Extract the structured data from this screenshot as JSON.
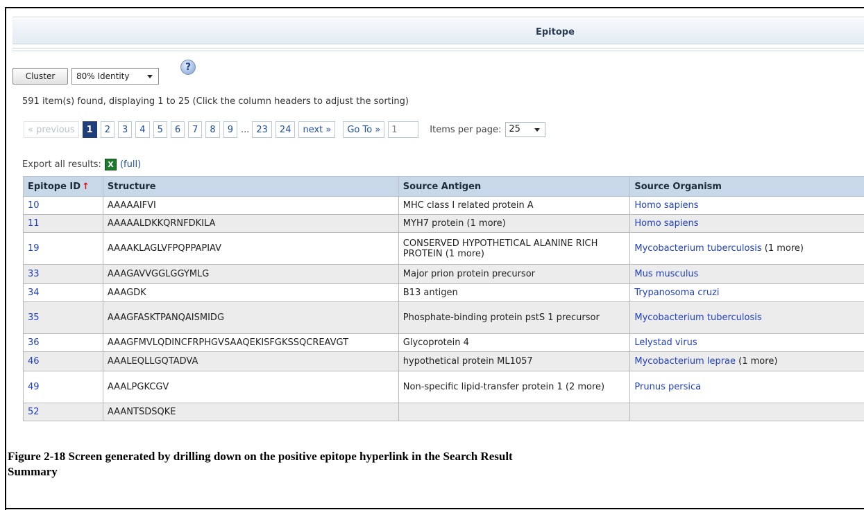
{
  "header": {
    "title": "Epitope"
  },
  "toolbar": {
    "cluster_label": "Cluster",
    "identity_value": "80% Identity",
    "help_icon_glyph": "?"
  },
  "summary": {
    "found_text": "591 item(s) found, displaying 1 to 25 (Click the column headers to adjust the sorting)"
  },
  "pager": {
    "previous_label": "« previous",
    "pages": [
      "1",
      "2",
      "3",
      "4",
      "5",
      "6",
      "7",
      "8",
      "9"
    ],
    "ellipsis": "...",
    "last_pages": [
      "23",
      "24"
    ],
    "current_page": "1",
    "next_label": "next »",
    "goto_label": "Go To »",
    "goto_value": "1",
    "items_per_page_label": "Items per page:",
    "items_per_page_value": "25"
  },
  "export": {
    "label": "Export all results:",
    "excel_icon_glyph": "X",
    "full_label": "(full)"
  },
  "table": {
    "columns": [
      "Epitope ID",
      "Structure",
      "Source Antigen",
      "Source Organism"
    ],
    "sort_arrow": "↑",
    "rows": [
      {
        "id": "10",
        "structure": "AAAAAIFVI",
        "antigen": "MHC class I related protein A",
        "organism": "Homo sapiens",
        "organism_more": ""
      },
      {
        "id": "11",
        "structure": "AAAAALDKKQRNFDKILA",
        "antigen": "MYH7 protein (1 more)",
        "organism": "Homo sapiens",
        "organism_more": ""
      },
      {
        "id": "19",
        "structure": "AAAAKLAGLVFPQPPAPIAV",
        "antigen": "CONSERVED HYPOTHETICAL ALANINE RICH PROTEIN (1 more)",
        "organism": "Mycobacterium tuberculosis",
        "organism_more": "(1 more)"
      },
      {
        "id": "33",
        "structure": "AAAGAVVGGLGGYMLG",
        "antigen": "Major prion protein precursor",
        "organism": "Mus musculus",
        "organism_more": ""
      },
      {
        "id": "34",
        "structure": "AAAGDK",
        "antigen": "B13 antigen",
        "organism": "Trypanosoma cruzi",
        "organism_more": ""
      },
      {
        "id": "35",
        "structure": "AAAGFASKTPANQAISMIDG",
        "antigen": "Phosphate-binding protein pstS 1 precursor",
        "organism": "Mycobacterium tuberculosis",
        "organism_more": ""
      },
      {
        "id": "36",
        "structure": "AAAGFMVLQDINCFRPHGVSAAQEKISFGKSSQCREAVGT",
        "antigen": "Glycoprotein 4",
        "organism": "Lelystad virus",
        "organism_more": ""
      },
      {
        "id": "46",
        "structure": "AAALEQLLGQTADVA",
        "antigen": "hypothetical protein ML1057",
        "organism": "Mycobacterium leprae",
        "organism_more": "(1 more)"
      },
      {
        "id": "49",
        "structure": "AAALPGKCGV",
        "antigen": "Non-specific lipid-transfer protein 1 (2 more)",
        "organism": "Prunus persica",
        "organism_more": ""
      },
      {
        "id": "52",
        "structure": "AAANTSDSQKE",
        "antigen": "",
        "organism": "",
        "organism_more": ""
      }
    ]
  },
  "caption": {
    "line1": "Figure 2-18  Screen generated by drilling down on the positive epitope hyperlink in the Search Result",
    "line2": "Summary"
  }
}
